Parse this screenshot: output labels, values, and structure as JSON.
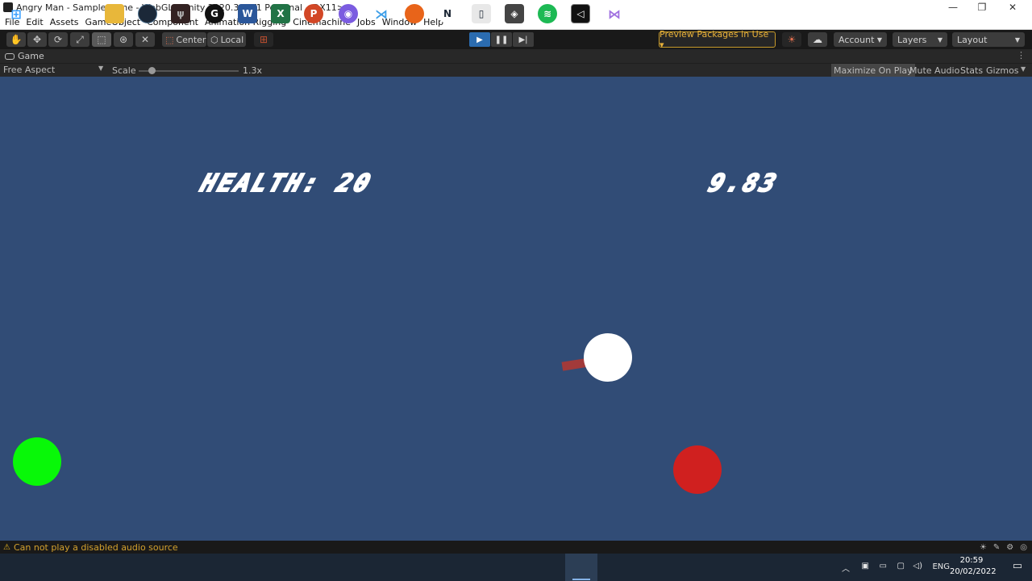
{
  "window": {
    "title": "Angry Man - SampleScene - WebGL - Unity 2020.3.11f1 Personal <DX11>",
    "minimize": "—",
    "maximize": "❐",
    "close": "✕"
  },
  "menu": [
    "File",
    "Edit",
    "Assets",
    "GameObject",
    "Component",
    "Animation Rigging",
    "Cinemachine",
    "Jobs",
    "Window",
    "Help"
  ],
  "toolbar": {
    "tools": [
      {
        "name": "hand-tool",
        "glyph": "✋"
      },
      {
        "name": "move-tool",
        "glyph": "✥"
      },
      {
        "name": "rotate-tool",
        "glyph": "⟳"
      },
      {
        "name": "scale-tool",
        "glyph": "⤢"
      },
      {
        "name": "rect-tool",
        "glyph": "⬚"
      },
      {
        "name": "transform-tool",
        "glyph": "⊛"
      },
      {
        "name": "custom-tool",
        "glyph": "✕"
      }
    ],
    "center_label": "Center",
    "local_label": "Local",
    "grid_glyph": "⊞",
    "play_glyph": "▶",
    "pause_glyph": "❚❚",
    "step_glyph": "▶|",
    "preview_packages": "Preview Packages in Use ▾",
    "account_label": "Account",
    "layers_label": "Layers",
    "layout_label": "Layout"
  },
  "game_view": {
    "tab_label": "Game",
    "aspect": "Free Aspect",
    "scale_label": "Scale",
    "scale_value": "1.3x",
    "scale_fraction": 0.13,
    "maximize_on_play": "Maximize On Play",
    "mute_audio": "Mute Audio",
    "stats": "Stats",
    "gizmos": "Gizmos"
  },
  "game": {
    "health_text": "HEALTH: 20",
    "timer_text": "9.83",
    "colors": {
      "background": "#314c76",
      "player": "#ffffff",
      "gun": "#a23a3a",
      "green": "#08f808",
      "red": "#d0201f"
    }
  },
  "status": {
    "message": "Can not play a disabled audio source"
  },
  "taskbar": {
    "language": "ENG",
    "time": "20:59",
    "date": "20/02/2022"
  }
}
